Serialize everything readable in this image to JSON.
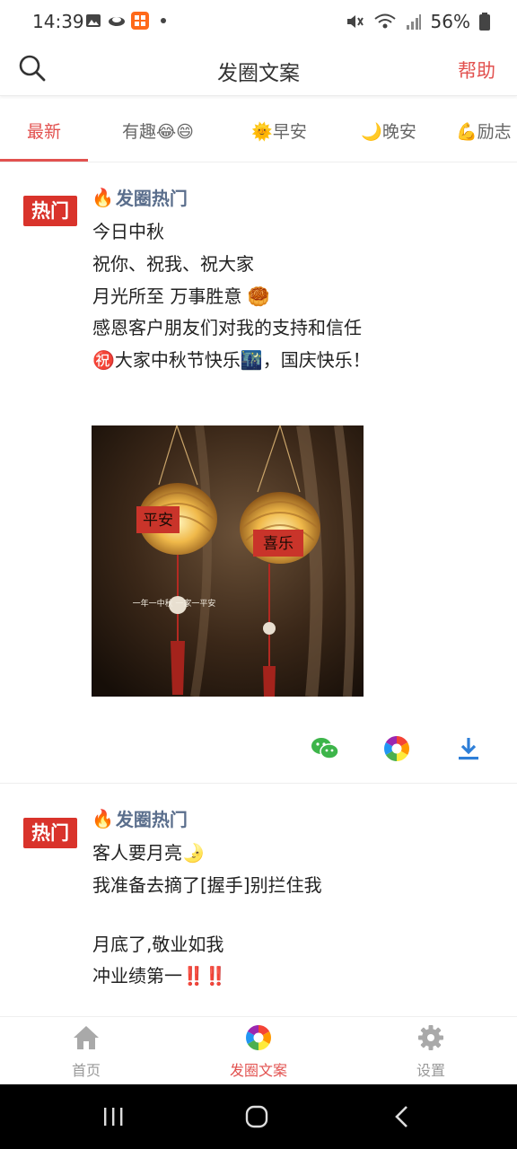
{
  "status_bar": {
    "time": "14:39",
    "battery": "56%"
  },
  "header": {
    "title": "发圈文案",
    "help": "帮助"
  },
  "tabs": [
    {
      "label": "最新",
      "active": true
    },
    {
      "label": "有趣😂😄",
      "active": false
    },
    {
      "label": "🌞早安",
      "active": false
    },
    {
      "label": "🌙晚安",
      "active": false
    },
    {
      "label": "💪励志",
      "active": false
    }
  ],
  "posts": [
    {
      "badge": "热门",
      "source": "发圈热门",
      "lines": [
        "今日中秋",
        "祝你、祝我、祝大家",
        "月光所至 万事胜意 🥮",
        "感恩客户朋友们对我的支持和信任",
        "㊗️大家中秋节快乐🌃，国庆快乐！"
      ],
      "image": {
        "lantern_left_text": "平安",
        "lantern_right_text": "喜乐",
        "caption": "一年一中秋 一家一平安"
      }
    },
    {
      "badge": "热门",
      "source": "发圈热门",
      "lines": [
        "客人要月亮🌛",
        "我准备去摘了[握手]别拦住我",
        "",
        "月底了,敬业如我",
        "冲业绩第一‼️‼️"
      ]
    }
  ],
  "bottom_nav": [
    {
      "label": "首页",
      "icon": "home-icon",
      "active": false
    },
    {
      "label": "发圈文案",
      "icon": "aperture-icon",
      "active": true
    },
    {
      "label": "设置",
      "icon": "gear-icon",
      "active": false
    }
  ],
  "colors": {
    "accent": "#e2514f",
    "badge": "#d9332b",
    "source": "#5a6e8c",
    "download": "#2e7fd8",
    "wechat": "#3db54a"
  }
}
